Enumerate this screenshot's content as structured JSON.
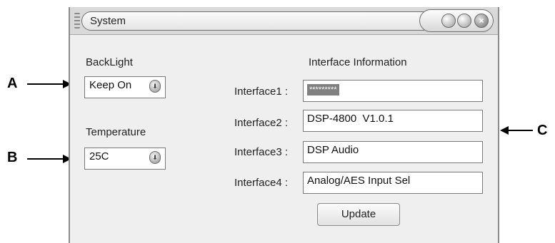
{
  "callouts": {
    "a": "A",
    "b": "B",
    "c": "C"
  },
  "window": {
    "title": "System",
    "close_glyph": "×",
    "icons": [
      "minimize-icon",
      "maximize-icon",
      "close-icon"
    ]
  },
  "backlight": {
    "label": "BackLight",
    "value": "Keep On",
    "dropdown_icon": "chevron-down-icon"
  },
  "temperature": {
    "label": "Temperature",
    "value": "25C",
    "dropdown_icon": "chevron-down-icon"
  },
  "interface_info": {
    "heading": "Interface Information",
    "rows": [
      {
        "label": "Interface1 :",
        "value": "*********"
      },
      {
        "label": "Interface2 :",
        "value": "DSP-4800  V1.0.1"
      },
      {
        "label": "Interface3 :",
        "value": "DSP Audio"
      },
      {
        "label": "Interface4 :",
        "value": "Analog/AES Input Sel"
      }
    ]
  },
  "update_button": {
    "label": "Update"
  },
  "drop_glyph": "⬇"
}
